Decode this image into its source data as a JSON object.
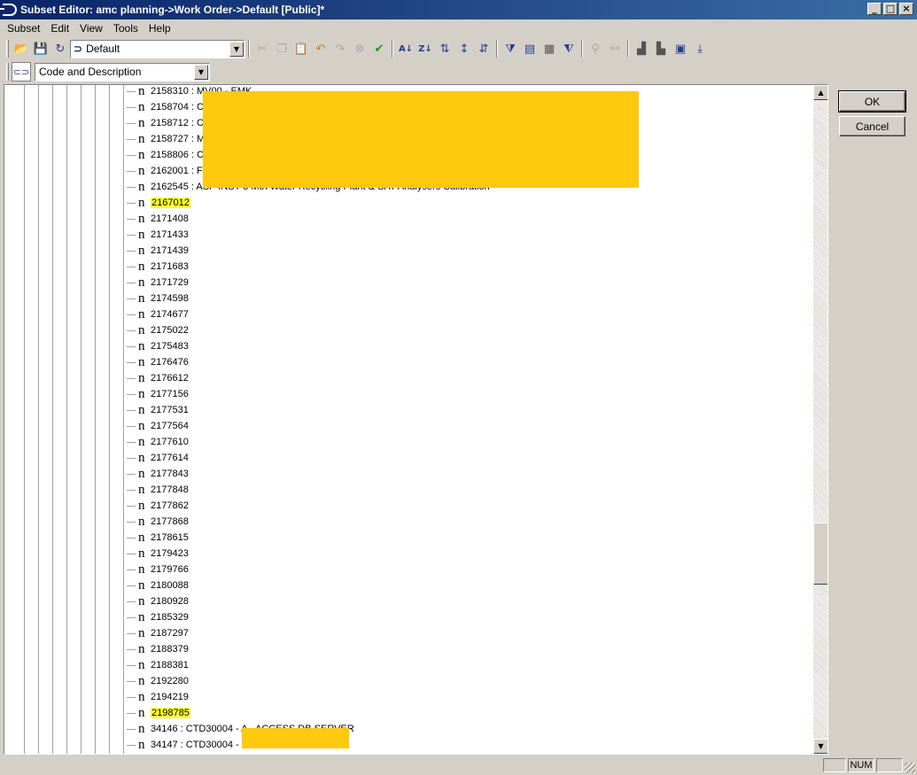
{
  "window": {
    "title": "Subset Editor:  amc planning->Work Order->Default  [Public]*",
    "minimize": "_",
    "maximize": "□",
    "close": "×"
  },
  "menu": [
    {
      "label": "Subset"
    },
    {
      "label": "Edit"
    },
    {
      "label": "View"
    },
    {
      "label": "Tools"
    },
    {
      "label": "Help"
    }
  ],
  "toolbar": {
    "subset_combo_value": "Default",
    "alias_combo_value": "Code and Description"
  },
  "tree": {
    "items": [
      {
        "text": "2158310 : MV00 - EMK",
        "highlighted": false
      },
      {
        "text": "2158704 : CT",
        "highlighted": false
      },
      {
        "text": "2158712 : CT",
        "highlighted": false
      },
      {
        "text": "2158727 : MV",
        "highlighted": false
      },
      {
        "text": "2158806 : CT",
        "highlighted": false
      },
      {
        "text": "2162001 : FI",
        "highlighted": false
      },
      {
        "text": "2162545 : ASP INST 3 Mth Water Recycling Plant & SAT Analysers Calibration",
        "highlighted": false
      },
      {
        "text": "2167012",
        "highlighted": true
      },
      {
        "text": "2171408",
        "highlighted": false
      },
      {
        "text": "2171433",
        "highlighted": false
      },
      {
        "text": "2171439",
        "highlighted": false
      },
      {
        "text": "2171683",
        "highlighted": false
      },
      {
        "text": "2171729",
        "highlighted": false
      },
      {
        "text": "2174598",
        "highlighted": false
      },
      {
        "text": "2174677",
        "highlighted": false
      },
      {
        "text": "2175022",
        "highlighted": false
      },
      {
        "text": "2175483",
        "highlighted": false
      },
      {
        "text": "2176476",
        "highlighted": false
      },
      {
        "text": "2176612",
        "highlighted": false
      },
      {
        "text": "2177156",
        "highlighted": false
      },
      {
        "text": "2177531",
        "highlighted": false
      },
      {
        "text": "2177564",
        "highlighted": false
      },
      {
        "text": "2177610",
        "highlighted": false
      },
      {
        "text": "2177614",
        "highlighted": false
      },
      {
        "text": "2177843",
        "highlighted": false
      },
      {
        "text": "2177848",
        "highlighted": false
      },
      {
        "text": "2177862",
        "highlighted": false
      },
      {
        "text": "2177868",
        "highlighted": false
      },
      {
        "text": "2178615",
        "highlighted": false
      },
      {
        "text": "2179423",
        "highlighted": false
      },
      {
        "text": "2179766",
        "highlighted": false
      },
      {
        "text": "2180088",
        "highlighted": false
      },
      {
        "text": "2180928",
        "highlighted": false
      },
      {
        "text": "2185329",
        "highlighted": false
      },
      {
        "text": "2187297",
        "highlighted": false
      },
      {
        "text": "2188379",
        "highlighted": false
      },
      {
        "text": "2188381",
        "highlighted": false
      },
      {
        "text": "2192280",
        "highlighted": false
      },
      {
        "text": "2194219",
        "highlighted": false
      },
      {
        "text": "2198785",
        "highlighted": true
      },
      {
        "text": "34146 : CTD30004 - A - ACCESS DB SERVER",
        "highlighted": false
      },
      {
        "text": "34147 : CTD30004 - C",
        "highlighted": false
      }
    ]
  },
  "buttons": {
    "ok": "OK",
    "cancel": "Cancel"
  },
  "status": {
    "num": "NUM"
  },
  "colors": {
    "title_start": "#0a246a",
    "title_end": "#3a6ea5",
    "highlight": "#ffff33",
    "redaction": "#ffc90e"
  }
}
